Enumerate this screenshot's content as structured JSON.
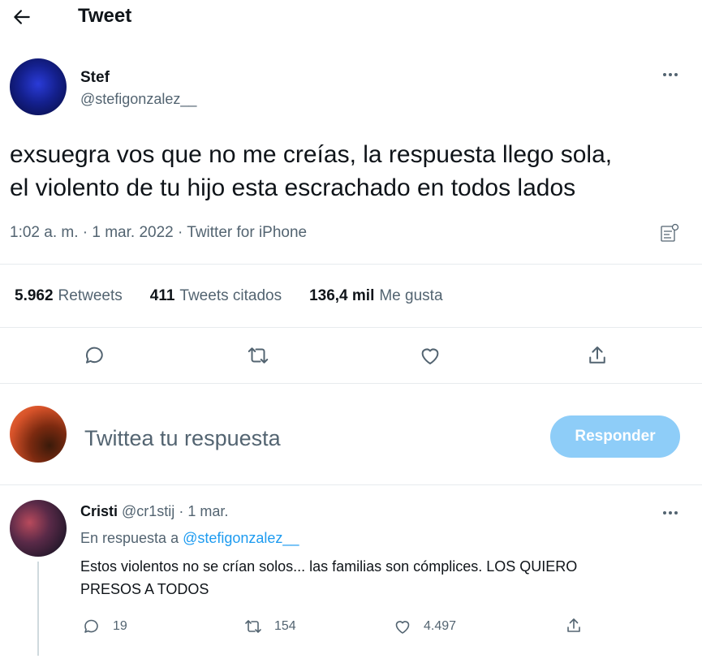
{
  "header": {
    "title": "Tweet",
    "back_icon": "arrow-left-icon"
  },
  "tweet": {
    "author": {
      "name": "Stef",
      "handle": "@stefigonzalez__"
    },
    "text_line1": "exsuegra vos que no me creías, la respuesta llego sola,",
    "text_line2": "el violento de tu hijo esta escrachado en todos lados",
    "meta": "1:02 a. m. · 1 mar. 2022 · Twitter for iPhone",
    "stats": {
      "retweets": {
        "count": "5.962",
        "label": "Retweets"
      },
      "quotes": {
        "count": "411",
        "label": "Tweets citados"
      },
      "likes": {
        "count": "136,4 mil",
        "label": "Me gusta"
      }
    },
    "actions": [
      "reply-icon",
      "retweet-icon",
      "like-icon",
      "share-icon"
    ]
  },
  "composer": {
    "placeholder": "Twittea tu respuesta",
    "button_label": "Responder",
    "button_color": "#8ecdf8"
  },
  "reply": {
    "name": "Cristi",
    "handle": "@cr1stij",
    "date": "· 1 mar.",
    "in_reply_prefix": "En respuesta a",
    "in_reply_handle": "@stefigonzalez__",
    "text_line1": "Estos violentos no se crían solos... las familias son cómplices. LOS QUIERO",
    "text_line2": "PRESOS A TODOS",
    "counts": {
      "replies": "19",
      "retweets": "154",
      "likes": "4.497"
    }
  },
  "colors": {
    "accent": "#1d9bf0",
    "muted": "#536471",
    "text": "#0f1419",
    "divider": "#e7ebee"
  }
}
